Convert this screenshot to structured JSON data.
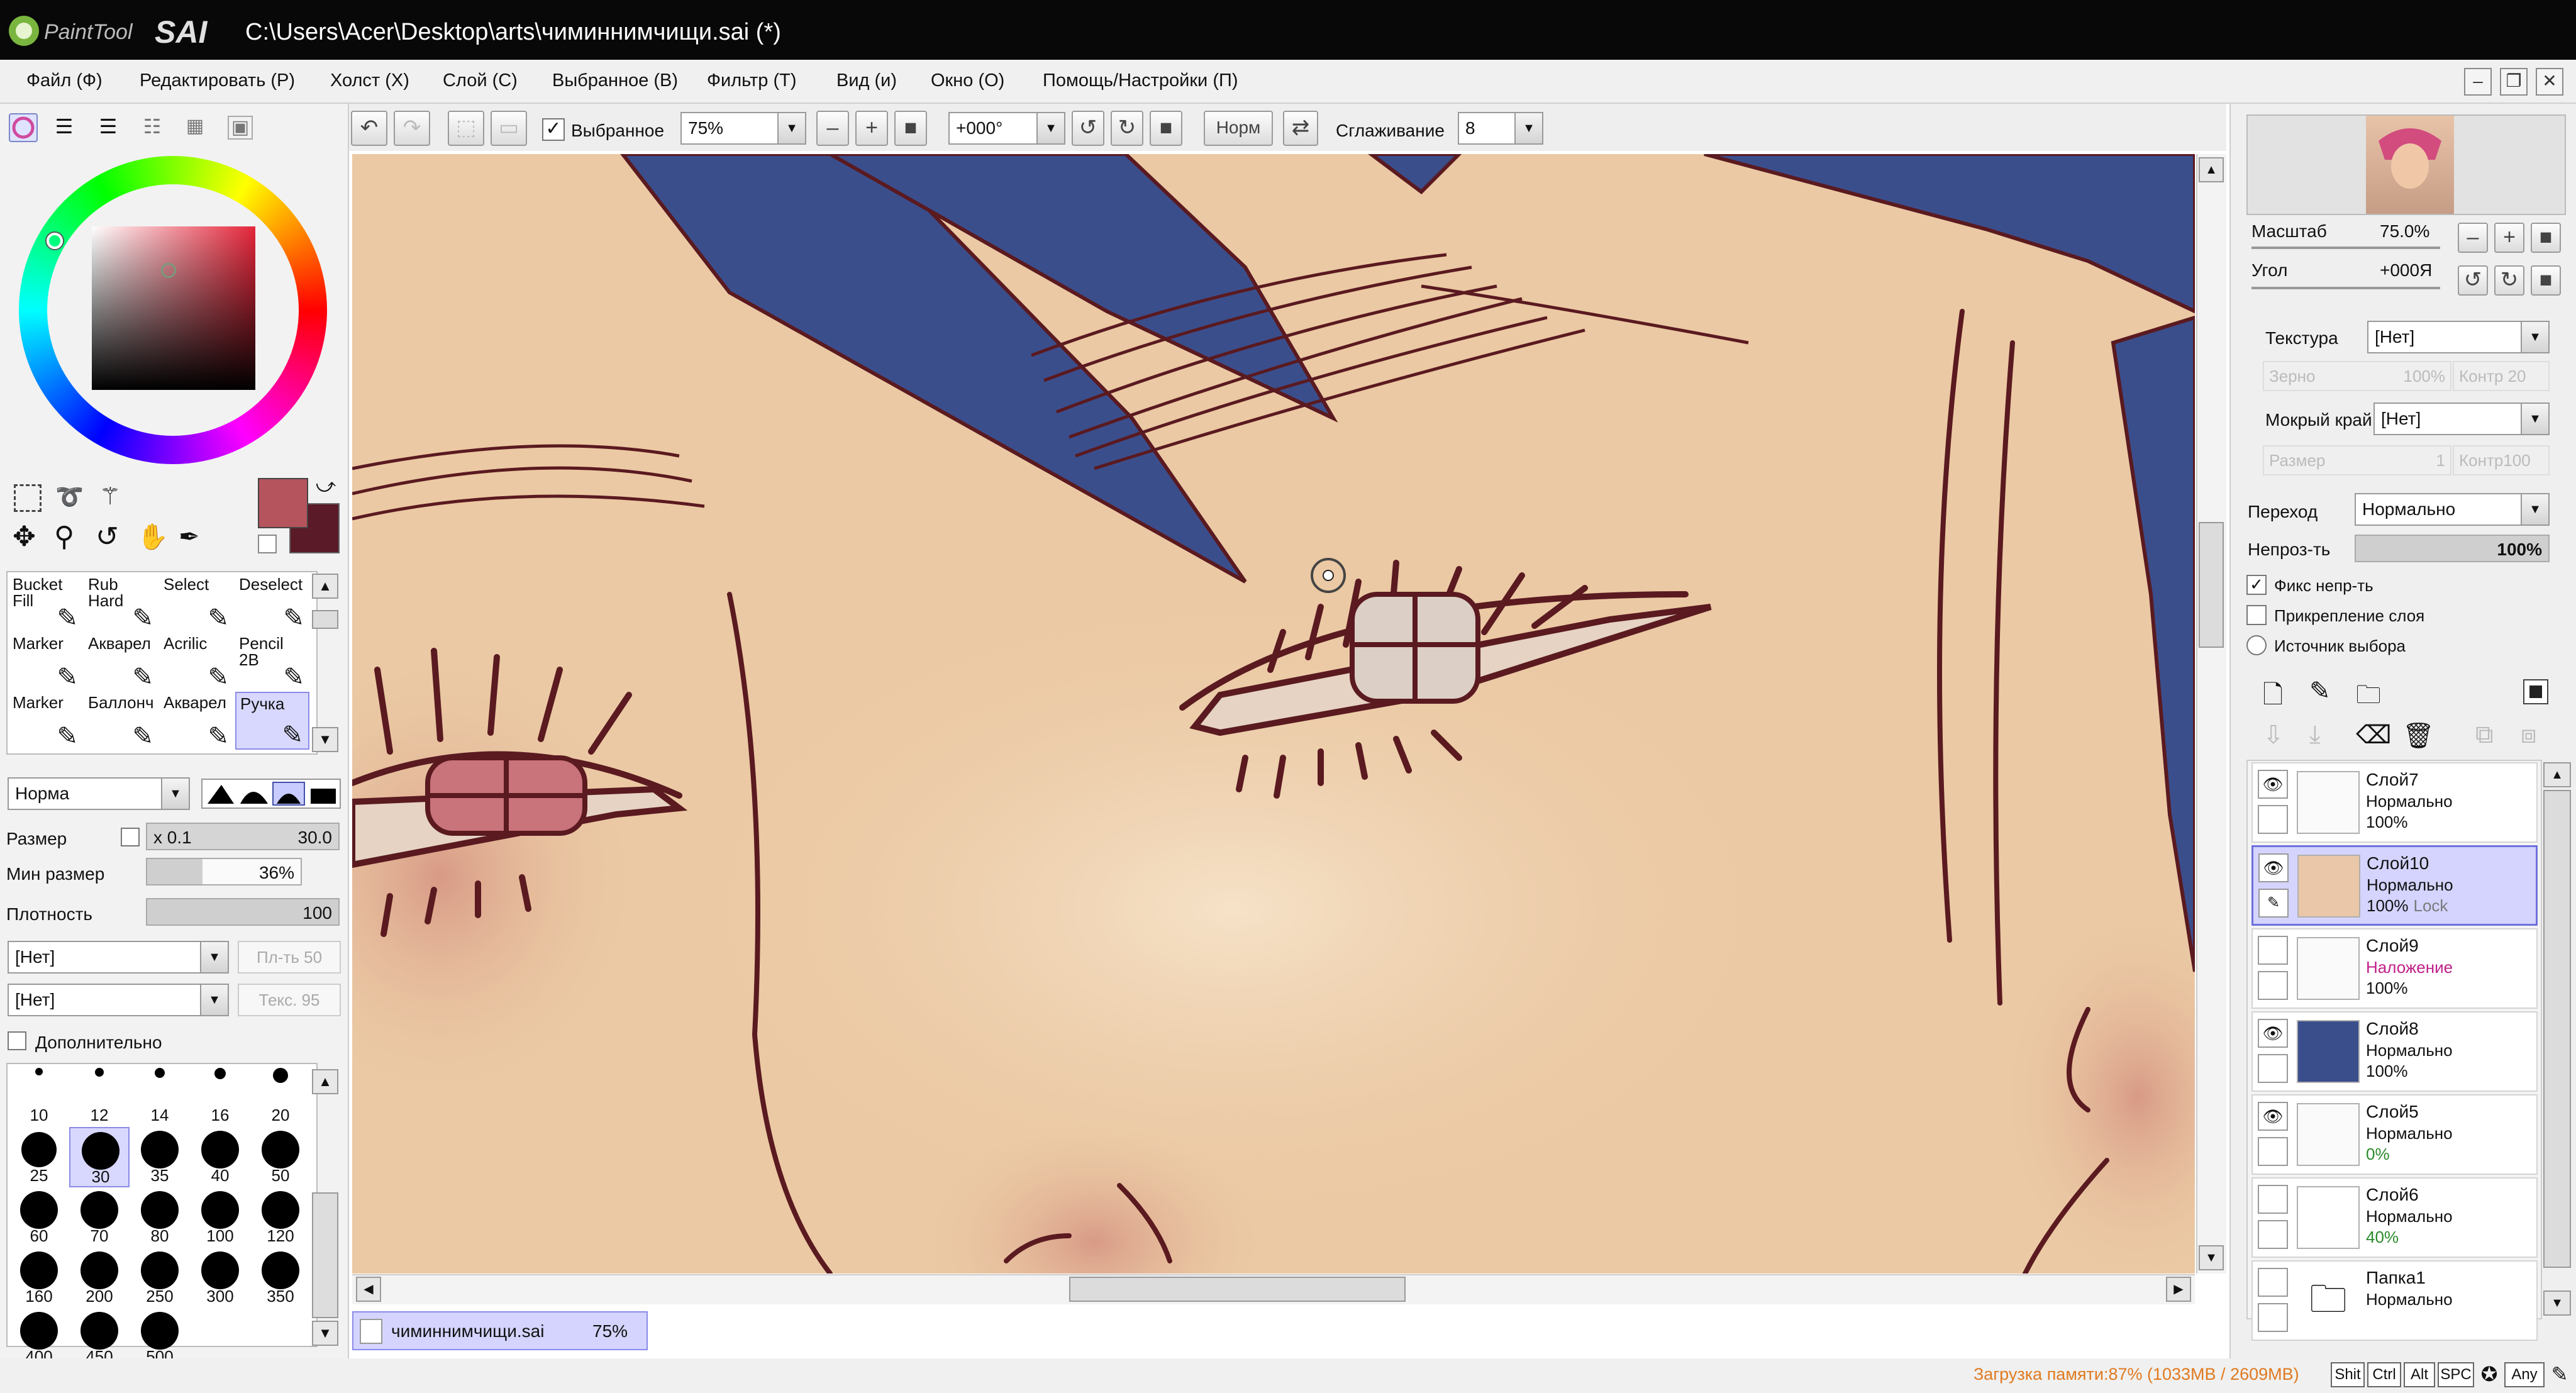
{
  "window": {
    "path": "C:\\Users\\Acer\\Desktop\\arts\\чиминнимчищи.sai (*)"
  },
  "menu": [
    "Файл (Ф)",
    "Редактировать (Р)",
    "Холст (Х)",
    "Слой (С)",
    "Выбранное (В)",
    "Фильтр (Т)",
    "Вид (и)",
    "Окно (О)",
    "Помощь/Настройки (П)"
  ],
  "toolbar": {
    "selection_label": "Выбранное",
    "selection_checked": true,
    "zoom_value": "75%",
    "angle_value": "+000°",
    "norm_label": "Норм",
    "smoothing_label": "Сглаживание",
    "smoothing_value": "8"
  },
  "colors": {
    "primary": "#b5545d",
    "secondary": "#5a1a28",
    "skin": "#ebc9a4",
    "hair": "#3b4e8c",
    "line": "#5a1a20"
  },
  "tools": {
    "row1": [
      {
        "top": "Bucket",
        "bottom": "Fill"
      },
      {
        "top": "Rub",
        "bottom": "Hard"
      },
      {
        "top": "Select",
        "bottom": ""
      },
      {
        "top": "Deselect",
        "bottom": ""
      }
    ],
    "row2": [
      {
        "top": "Marker",
        "bottom": ""
      },
      {
        "top": "Акварел",
        "bottom": ""
      },
      {
        "top": "Acrilic",
        "bottom": ""
      },
      {
        "top": "Pencil",
        "bottom": "2B"
      }
    ],
    "row3": [
      {
        "top": "Marker",
        "bottom": ""
      },
      {
        "top": "Баллонч",
        "bottom": ""
      },
      {
        "top": "Акварел",
        "bottom": ""
      },
      {
        "top": "Ручка",
        "bottom": ""
      }
    ]
  },
  "brush": {
    "blend_mode": "Норма",
    "size_label": "Размер",
    "size_mult": "x 0.1",
    "size_value": "30.0",
    "min_size_label": "Мин размер",
    "min_size_value": "36%",
    "min_size_fraction": 0.36,
    "density_label": "Плотность",
    "density_value": "100",
    "texture1": "[Нет]",
    "texture1_right": "Пл-ть  50",
    "texture2": "[Нет]",
    "texture2_right": "Текс.  95",
    "advanced_label": "Дополнительно"
  },
  "brush_sizes": [
    "10",
    "12",
    "14",
    "16",
    "20",
    "25",
    "30",
    "35",
    "40",
    "50",
    "60",
    "70",
    "80",
    "100",
    "120",
    "160",
    "200",
    "250",
    "300",
    "350",
    "400",
    "450",
    "500"
  ],
  "navigator": {
    "scale_label": "Масштаб",
    "scale_value": "75.0%",
    "angle_label": "Угол",
    "angle_value": "+000Я"
  },
  "layer_props": {
    "texture_label": "Текстура",
    "texture_value": "[Нет]",
    "grain_label": "Зерно",
    "grain_value": "100%",
    "contrast_label": "Контр",
    "contrast_value": "20",
    "wet_label": "Мокрый край",
    "wet_value": "[Нет]",
    "wsize_label": "Размер",
    "wsize_value": "1",
    "wcontrast_label": "Контр",
    "wcontrast_value": "100",
    "blend_label": "Переход",
    "blend_value": "Нормально",
    "opacity_label": "Непроз-ть",
    "opacity_value": "100%",
    "preserve_label": "Фикс непр-ть",
    "clip_label": "Прикрепление слоя",
    "source_label": "Источник выбора"
  },
  "layers": [
    {
      "name": "Слой7",
      "mode": "Нормально",
      "opacity": "100%",
      "visible": true,
      "selected": false,
      "lock": ""
    },
    {
      "name": "Слой10",
      "mode": "Нормально",
      "opacity": "100%",
      "visible": true,
      "selected": true,
      "lock": "Lock"
    },
    {
      "name": "Слой9",
      "mode": "Наложение",
      "opacity": "100%",
      "visible": false,
      "selected": false,
      "lock": ""
    },
    {
      "name": "Слой8",
      "mode": "Нормально",
      "opacity": "100%",
      "visible": true,
      "selected": false,
      "lock": ""
    },
    {
      "name": "Слой5",
      "mode": "Нормально",
      "opacity": "0%",
      "visible": true,
      "selected": false,
      "lock": ""
    },
    {
      "name": "Слой6",
      "mode": "Нормально",
      "opacity": "40%",
      "visible": false,
      "selected": false,
      "lock": ""
    },
    {
      "name": "Папка1",
      "mode": "Нормально",
      "opacity": "",
      "visible": false,
      "selected": false,
      "lock": ""
    }
  ],
  "doc_tab": {
    "name": "чиминнимчищи.sai",
    "zoom": "75%"
  },
  "status": {
    "memory": "Загрузка памяти:87% (1033MB / 2609MB)",
    "keys": [
      "Shit",
      "Ctrl",
      "Alt",
      "SPC"
    ],
    "any": "Any"
  }
}
